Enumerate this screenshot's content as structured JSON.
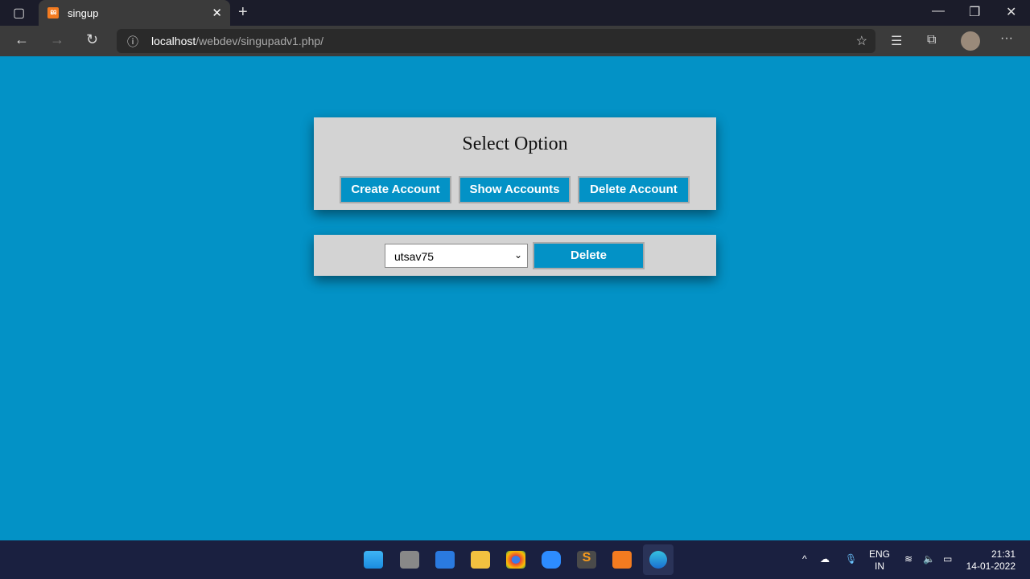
{
  "browser": {
    "tab_title": "singup",
    "url_host": "localhost",
    "url_path": "/webdev/singupadv1.php/"
  },
  "panel": {
    "title": "Select Option",
    "buttons": [
      "Create Account",
      "Show Accounts",
      "Delete Account"
    ]
  },
  "delete_form": {
    "selected_user": "utsav75",
    "delete_label": "Delete"
  },
  "taskbar": {
    "lang": "ENG",
    "region": "IN",
    "time": "21:31",
    "date": "14-01-2022",
    "apps": [
      "start",
      "task-view",
      "widgets",
      "file-explorer",
      "chrome",
      "zoom",
      "sublime-text",
      "xampp",
      "edge"
    ]
  },
  "colors": {
    "background": "#0392c6",
    "panel": "#d3d3d3"
  }
}
